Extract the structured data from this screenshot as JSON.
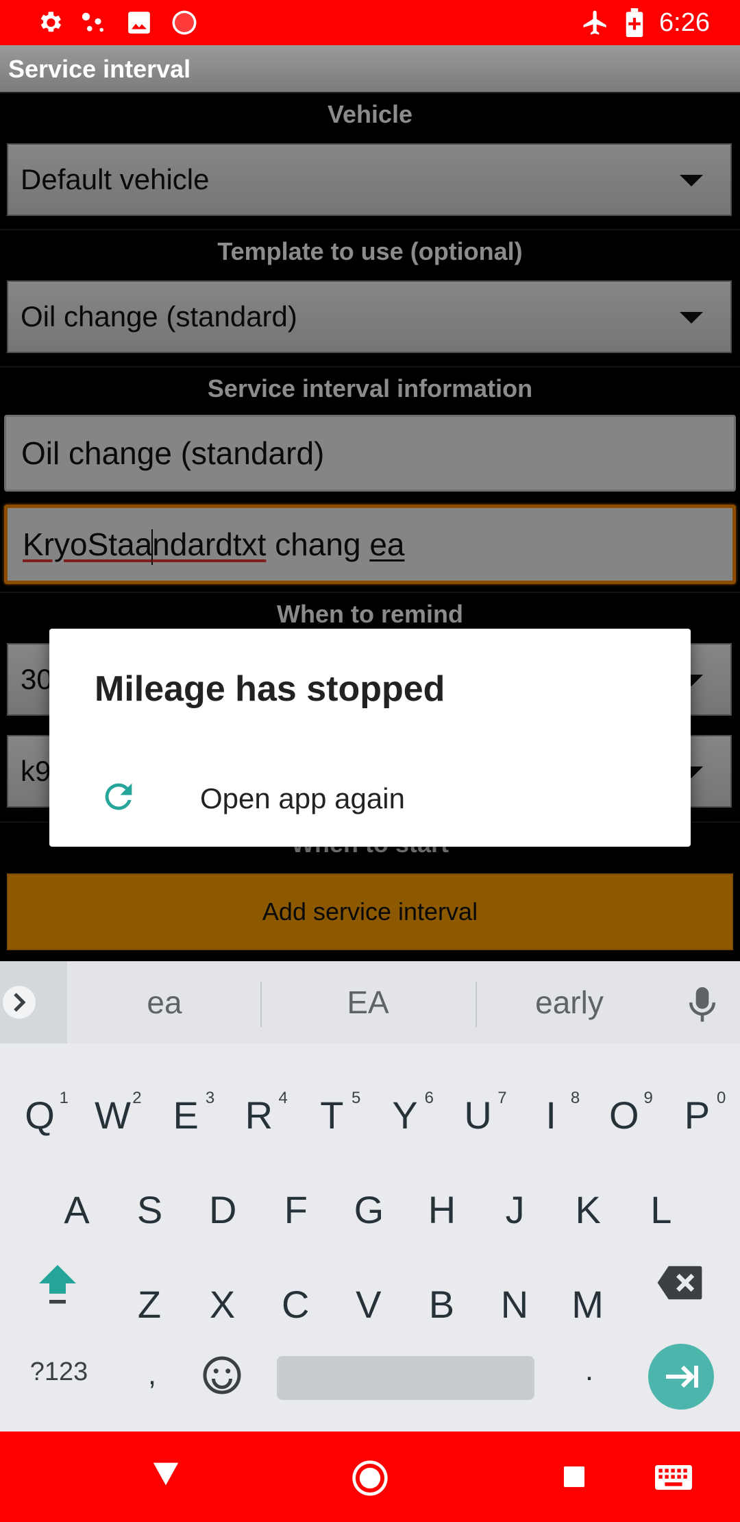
{
  "status_bar": {
    "time": "6:26",
    "icons_left": [
      "settings-icon",
      "share-dots-icon",
      "image-icon",
      "record-icon"
    ],
    "icons_right": [
      "airplane-icon",
      "battery-icon"
    ]
  },
  "app": {
    "title": "Service interval",
    "sections": {
      "vehicle": "Vehicle",
      "template": "Template to use (optional)",
      "info": "Service interval information",
      "remind": "When to remind",
      "start": "When to start"
    },
    "vehicle_select": "Default vehicle",
    "template_select": "Oil change (standard)",
    "name_field": "Oil change (standard)",
    "desc_field": {
      "part1": "KryoStaa",
      "part2": "ndardtxt",
      "part3": " chang ",
      "part4": "ea"
    },
    "remind_value_visible": "30",
    "remind_unit_visible": "k9",
    "add_button": "Add service interval"
  },
  "dialog": {
    "title": "Mileage has stopped",
    "action": "Open app again"
  },
  "keyboard": {
    "suggestions": [
      "ea",
      "EA",
      "early"
    ],
    "row1": [
      "Q",
      "W",
      "E",
      "R",
      "T",
      "Y",
      "U",
      "I",
      "O",
      "P"
    ],
    "row1_hints": [
      "1",
      "2",
      "3",
      "4",
      "5",
      "6",
      "7",
      "8",
      "9",
      "0"
    ],
    "row2": [
      "A",
      "S",
      "D",
      "F",
      "G",
      "H",
      "J",
      "K",
      "L"
    ],
    "row3": [
      "Z",
      "X",
      "C",
      "V",
      "B",
      "N",
      "M"
    ],
    "symbols_key": "?123",
    "comma": ",",
    "period": "."
  },
  "colors": {
    "status_bar": "#ff0000",
    "accent": "#ffa000",
    "focus_border": "#ff8a00",
    "dialog_icon": "#26a69a",
    "enter_key": "#4db6ac"
  }
}
